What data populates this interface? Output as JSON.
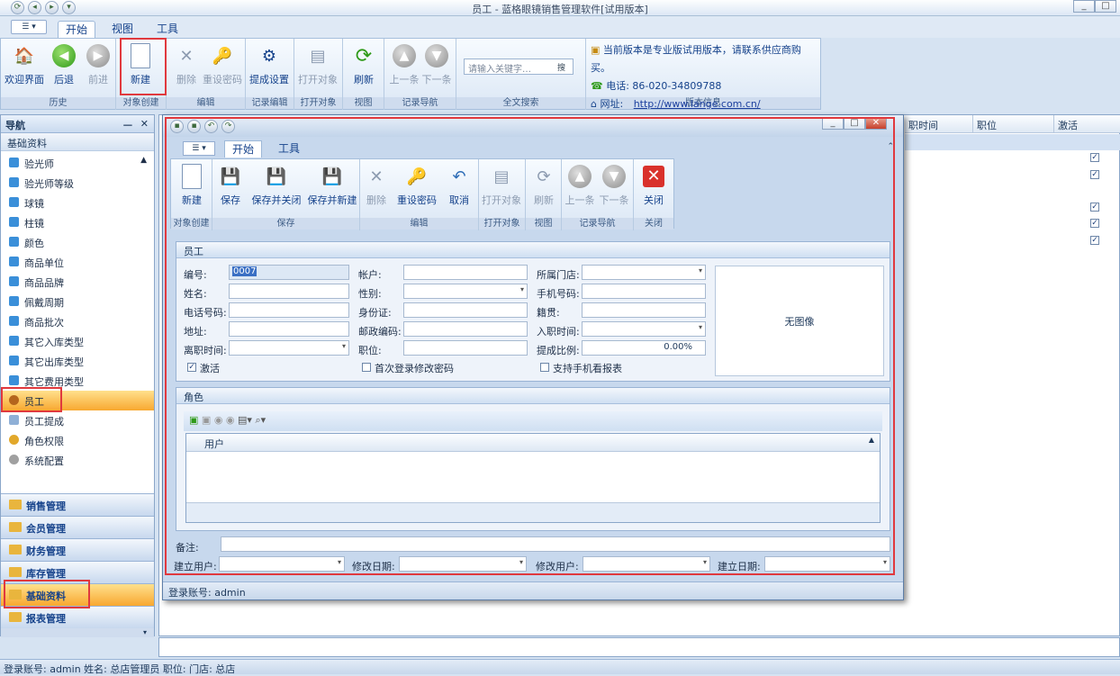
{
  "app": {
    "title": "员工 - 蓝格眼镜销售管理软件[试用版本]"
  },
  "ribbon": {
    "tabs": [
      "开始",
      "视图",
      "工具"
    ],
    "groups": [
      {
        "label": "历史",
        "buttons": [
          "欢迎界面",
          "后退",
          "前进"
        ]
      },
      {
        "label": "对象创建",
        "buttons": [
          "新建"
        ]
      },
      {
        "label": "编辑",
        "buttons": [
          "删除",
          "重设密码"
        ]
      },
      {
        "label": "记录编辑",
        "buttons": [
          "提成设置"
        ]
      },
      {
        "label": "打开对象",
        "buttons": [
          "打开对象"
        ]
      },
      {
        "label": "视图",
        "buttons": [
          "刷新"
        ]
      },
      {
        "label": "记录导航",
        "buttons": [
          "上一条",
          "下一条"
        ]
      },
      {
        "label": "全文搜索"
      },
      {
        "label": "版本信息"
      }
    ],
    "search_placeholder": "请输入关键字…",
    "search_button": "搜",
    "info": {
      "line1": "当前版本是专业版试用版本，请联系供应商购买。",
      "phone": "电话:   86-020-34809788",
      "site_label": "网址:",
      "site_url": "http://www.lange.com.cn/"
    }
  },
  "nav": {
    "header": "导航",
    "pin": "ᅳ",
    "close": "✕",
    "section": "基础资料",
    "items": [
      "验光师",
      "验光师等级",
      "球镜",
      "柱镜",
      "颜色",
      "商品单位",
      "商品品牌",
      "佩戴周期",
      "商品批次",
      "其它入库类型",
      "其它出库类型",
      "其它费用类型",
      "员工",
      "员工提成",
      "角色权限",
      "系统配置"
    ],
    "categories": [
      "销售管理",
      "会员管理",
      "财务管理",
      "库存管理",
      "基础资料",
      "报表管理"
    ]
  },
  "grid": {
    "headers": [
      "职时间",
      "职位",
      "激活"
    ]
  },
  "dialog": {
    "tabs": [
      "开始",
      "工具"
    ],
    "groups": [
      {
        "label": "对象创建",
        "buttons": [
          "新建"
        ]
      },
      {
        "label": "保存",
        "buttons": [
          "保存",
          "保存并关闭",
          "保存并新建"
        ]
      },
      {
        "label": "编辑",
        "buttons": [
          "删除",
          "重设密码",
          "取消"
        ]
      },
      {
        "label": "打开对象",
        "buttons": [
          "打开对象"
        ]
      },
      {
        "label": "视图",
        "buttons": [
          "刷新"
        ]
      },
      {
        "label": "记录导航",
        "buttons": [
          "上一条",
          "下一条"
        ]
      },
      {
        "label": "关闭",
        "buttons": [
          "关闭"
        ]
      }
    ],
    "employee_panel": "员工",
    "fields": {
      "code_label": "编号:",
      "code_value": "0007",
      "account_label": "帐户:",
      "store_label": "所属门店:",
      "name_label": "姓名:",
      "gender_label": "性别:",
      "mobile_label": "手机号码:",
      "phone_label": "电话号码:",
      "id_label": "身份证:",
      "native_label": "籍贯:",
      "address_label": "地址:",
      "zip_label": "邮政编码:",
      "join_label": "入职时间:",
      "leave_label": "离职时间:",
      "position_label": "职位:",
      "rate_label": "提成比例:",
      "rate_value": "0.00%",
      "active_label": "激活",
      "first_login_label": "首次登录修改密码",
      "mobile_report_label": "支持手机看报表",
      "no_photo": "无图像"
    },
    "role_panel": "角色",
    "role_column": "用户",
    "remark_label": "备注:",
    "footer": {
      "creator_label": "建立用户:",
      "mod_date_label": "修改日期:",
      "mod_user_label": "修改用户:",
      "create_date_label": "建立日期:"
    },
    "status": "登录账号: admin"
  },
  "statusbar": "登录账号: admin   姓名: 总店管理员   职位:    门店: 总店"
}
